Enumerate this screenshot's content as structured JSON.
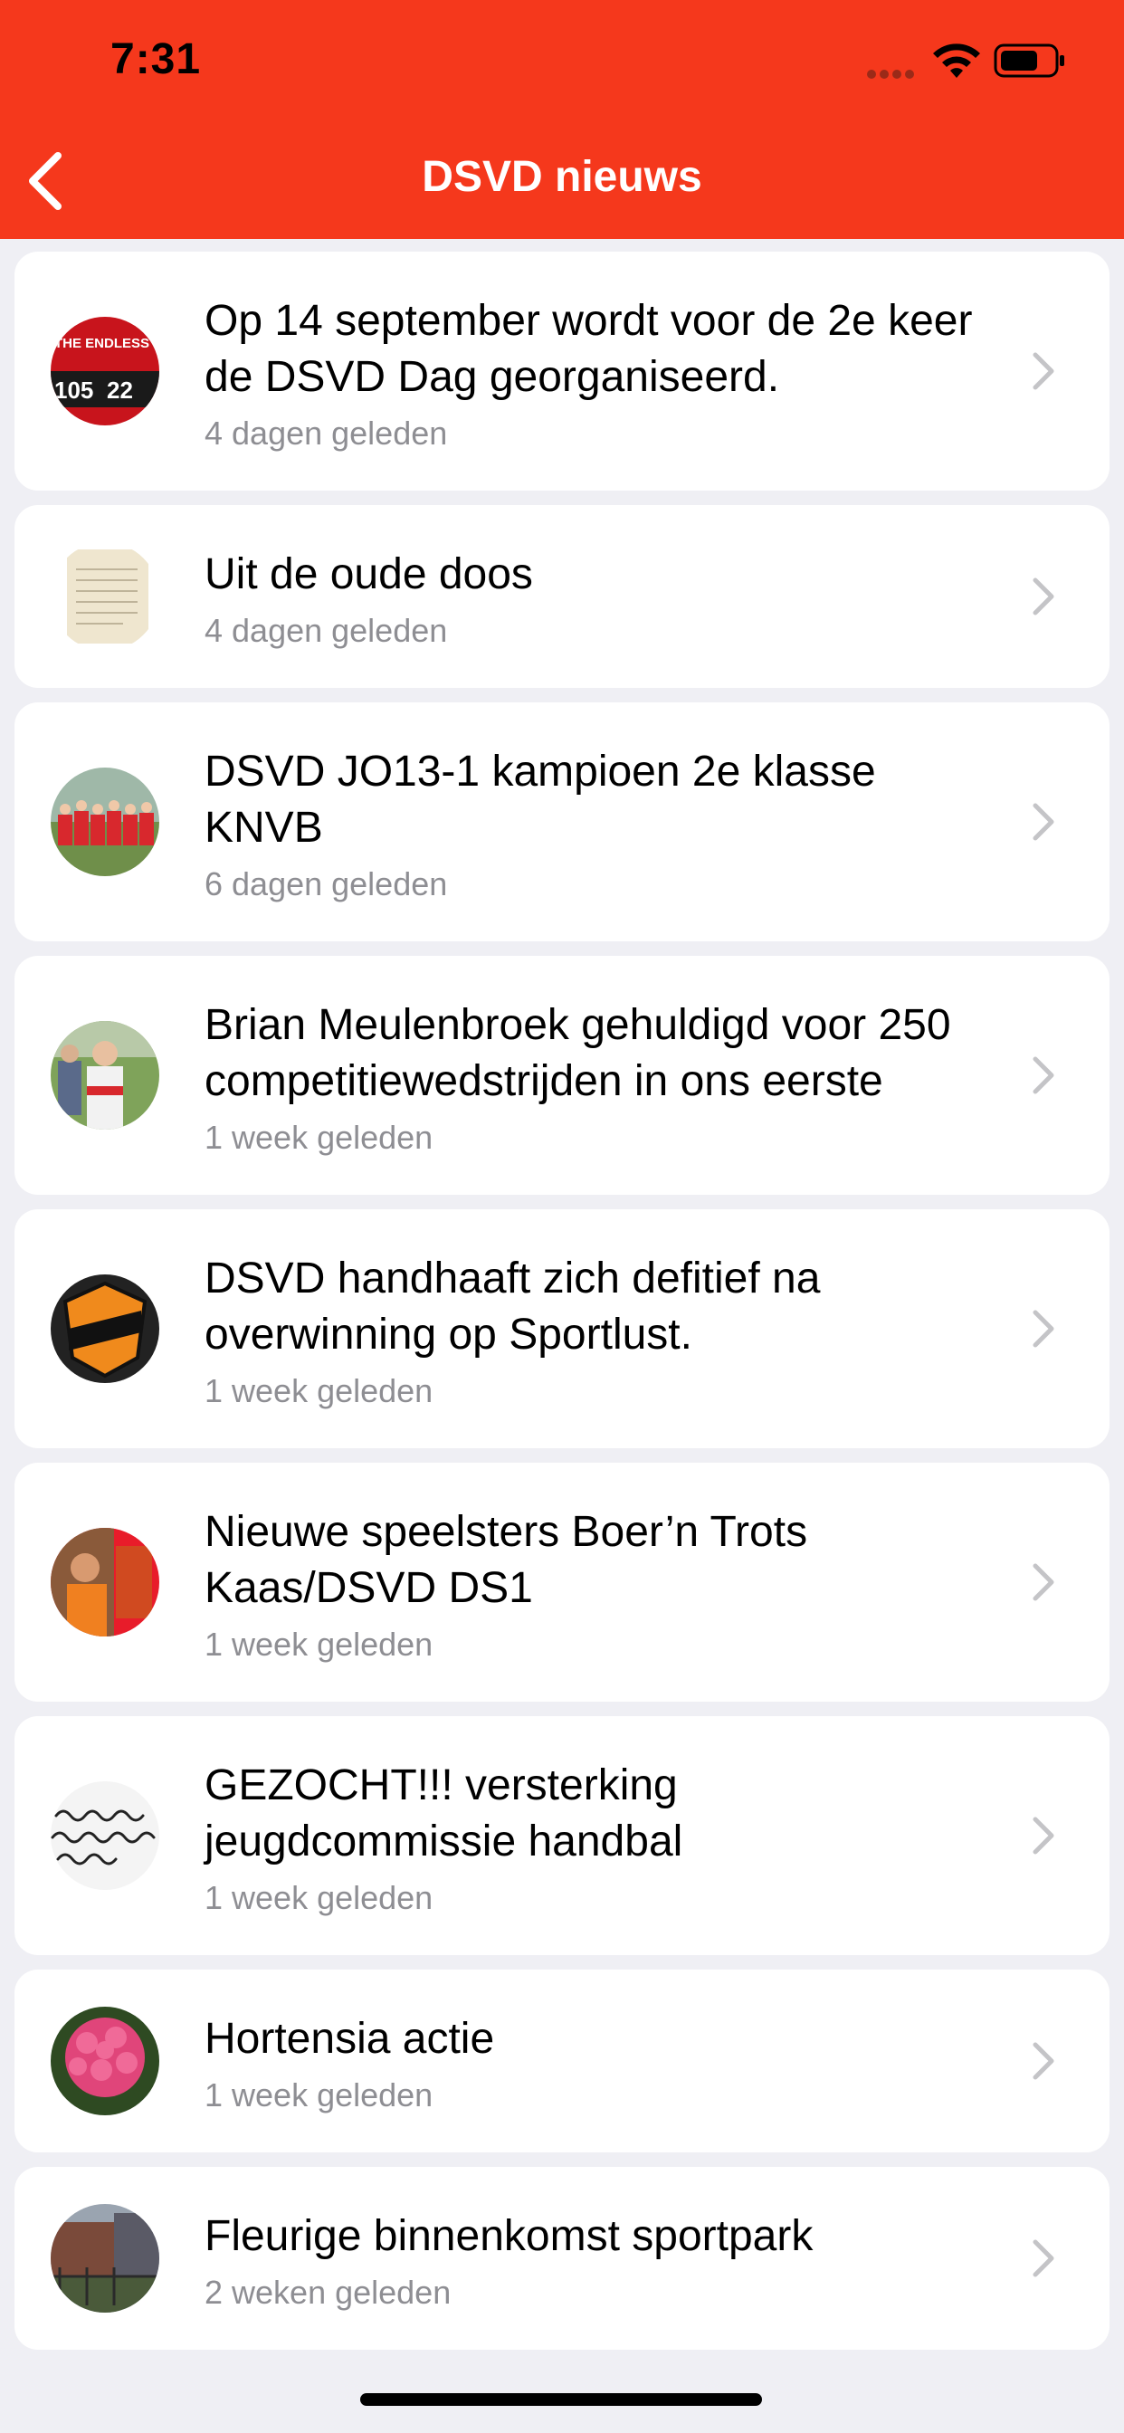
{
  "status_bar": {
    "time": "7:31"
  },
  "nav": {
    "title": "DSVD nieuws"
  },
  "thumb_text": {
    "scoreboard": "THE ENDLESS C",
    "score_a": "105",
    "score_b": "22"
  },
  "articles": [
    {
      "title": "Op 14 september wordt voor de 2e keer de DSVD Dag  georganiseerd.",
      "time": "4 dagen geleden",
      "thumb": "scoreboard-thumbnail"
    },
    {
      "title": "Uit de oude doos",
      "time": "4 dagen geleden",
      "thumb": "old-document-thumbnail"
    },
    {
      "title": "DSVD JO13-1 kampioen 2e klasse KNVB",
      "time": "6 dagen geleden",
      "thumb": "team-photo-thumbnail"
    },
    {
      "title": "Brian Meulenbroek gehuldigd voor 250 competitiewedstrijden in ons eerste",
      "time": "1 week geleden",
      "thumb": "player-photo-thumbnail"
    },
    {
      "title": "DSVD handhaaft zich defitief na overwinning op Sportlust.",
      "time": "1 week geleden",
      "thumb": "club-logo-thumbnail"
    },
    {
      "title": "Nieuwe speelsters Boer’n Trots Kaas/DSVD DS1",
      "time": "1 week geleden",
      "thumb": "players-thumbnail"
    },
    {
      "title": "GEZOCHT!!! versterking jeugdcommissie handbal",
      "time": "1 week geleden",
      "thumb": "handwriting-thumbnail"
    },
    {
      "title": "Hortensia actie",
      "time": "1 week geleden",
      "thumb": "flower-thumbnail"
    },
    {
      "title": "Fleurige binnenkomst sportpark",
      "time": "2 weken geleden",
      "thumb": "sportpark-thumbnail"
    }
  ],
  "colors": {
    "accent": "#f5381c",
    "background": "#efeff4",
    "subtitle": "#8e8e93",
    "chevron": "#c4c4c7"
  },
  "icons": {
    "back": "chevron-left-icon",
    "row": "chevron-right-icon",
    "wifi": "wifi-icon",
    "battery": "battery-icon"
  }
}
